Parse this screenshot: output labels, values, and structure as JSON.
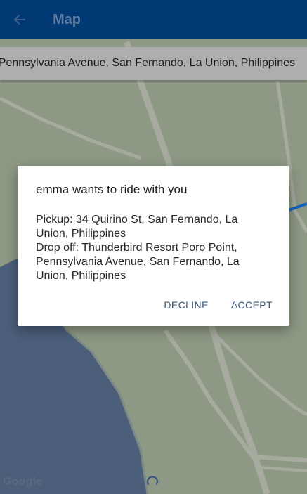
{
  "app_bar": {
    "title": "Map",
    "back_icon": "arrow-back-icon",
    "background": "#003974",
    "title_color": "#5b7aa0"
  },
  "address_bar": {
    "text": "Pennsylvania Avenue, San Fernando, La Union, Philippines"
  },
  "dialog": {
    "title": "emma wants to ride with you",
    "pickup": "Pickup: 34 Quirino St, San Fernando, La Union, Philippines",
    "dropoff": "Drop off: Thunderbird Resort Poro Point, Pennsylvania Avenue, San Fernando, La Union, Philippines",
    "decline_label": "DECLINE",
    "accept_label": "ACCEPT",
    "button_color": "#3b5675"
  },
  "map": {
    "attribution": "Google",
    "land_color": "#8f9a86",
    "water_color": "#4a5e7a",
    "road_color": "#a3a89c",
    "route_color": "#1565c0",
    "loading_icon": "spinner-icon"
  }
}
